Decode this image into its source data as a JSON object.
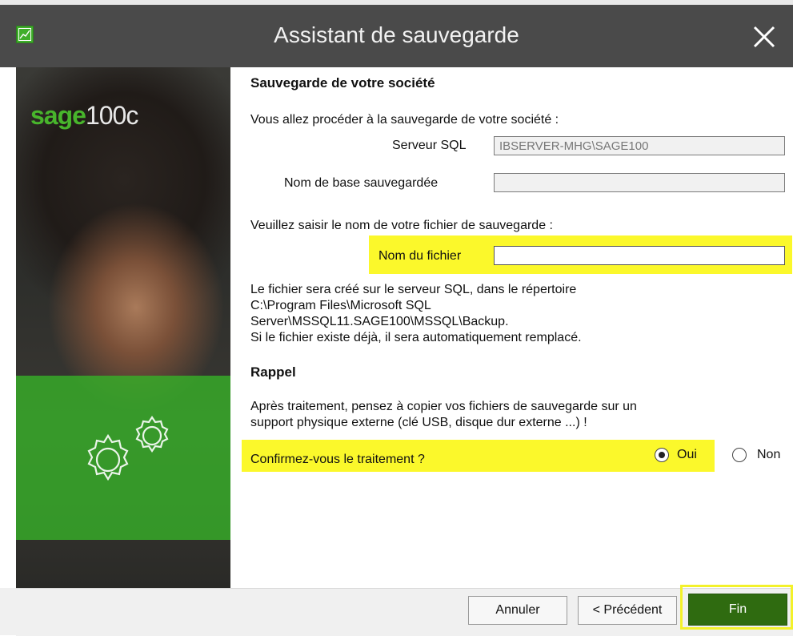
{
  "window": {
    "title": "Assistant de sauvegarde",
    "close_glyph": "✕"
  },
  "brand": {
    "sage": "sage",
    "product": "100c"
  },
  "section1": {
    "heading": "Sauvegarde de votre société",
    "intro": "Vous allez procéder à la sauvegarde de votre société :",
    "server_label": "Serveur SQL",
    "server_value": "IBSERVER-MHG\\SAGE100",
    "dbname_label": "Nom de base sauvegardée",
    "dbname_value": ""
  },
  "file": {
    "prompt": "Veuillez saisir le nom de votre fichier de sauvegarde :",
    "label": "Nom du fichier",
    "value": "",
    "note_line1": "Le fichier sera créé sur le serveur SQL, dans le répertoire",
    "note_line2": "C:\\Program Files\\Microsoft SQL",
    "note_line3": "Server\\MSSQL11.SAGE100\\MSSQL\\Backup.",
    "note_line4": "Si le fichier existe déjà, il sera automatiquement remplacé."
  },
  "reminder": {
    "heading": "Rappel",
    "line1": "Après traitement, pensez à copier vos fichiers de sauvegarde sur un",
    "line2": "support physique externe (clé USB, disque dur externe ...) !"
  },
  "confirm": {
    "question": "Confirmez-vous le traitement ?",
    "yes_label": "Oui",
    "no_label": "Non",
    "selected": "Oui"
  },
  "buttons": {
    "cancel": "Annuler",
    "previous": "< Précédent",
    "finish": "Fin"
  },
  "colors": {
    "titlebar": "#4a4a4a",
    "sage_green": "#48b52c",
    "highlight": "#fbf82b",
    "finish_button": "#2f6b10"
  },
  "icons": {
    "app": "chart-icon",
    "close": "close-icon",
    "gears": "gears-icon"
  }
}
